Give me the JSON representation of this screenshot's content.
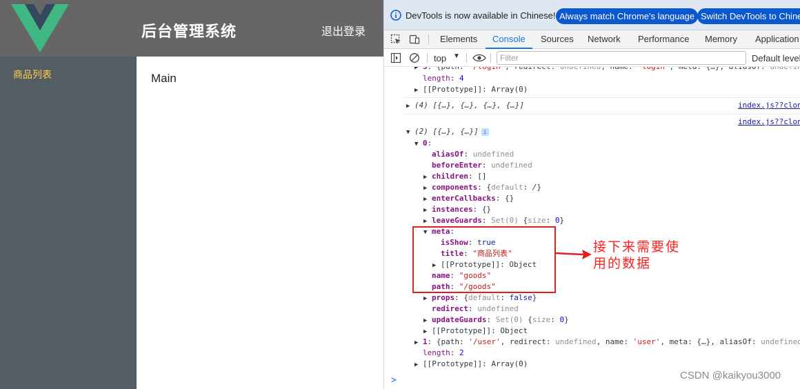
{
  "app": {
    "title": "后台管理系统",
    "logout_label": "退出登录",
    "menu_items": [
      {
        "label": "商品列表"
      }
    ],
    "main_text": "Main",
    "colors": {
      "header": "#666666",
      "aside": "#545c64",
      "menu_active": "#ffd04b",
      "vue_green": "#41b883",
      "vue_dark": "#35495e"
    }
  },
  "devtools": {
    "infobar": {
      "text": "DevTools is now available in Chinese!",
      "button_match": "Always match Chrome's language",
      "button_switch": "Switch DevTools to Chinese"
    },
    "tabs": [
      {
        "label": "Elements"
      },
      {
        "label": "Console",
        "active": true
      },
      {
        "label": "Sources"
      },
      {
        "label": "Network"
      },
      {
        "label": "Performance"
      },
      {
        "label": "Memory"
      },
      {
        "label": "Application"
      }
    ],
    "toolbar": {
      "context": "top",
      "filter_placeholder": "Filter",
      "levels": "Default levels"
    },
    "console": {
      "source_link": "index.js??clone",
      "prompt": ">"
    }
  },
  "annotation": {
    "line1": "接下来需要使",
    "line2": "用的数据"
  },
  "watermark": "CSDN @kaikyou3000"
}
